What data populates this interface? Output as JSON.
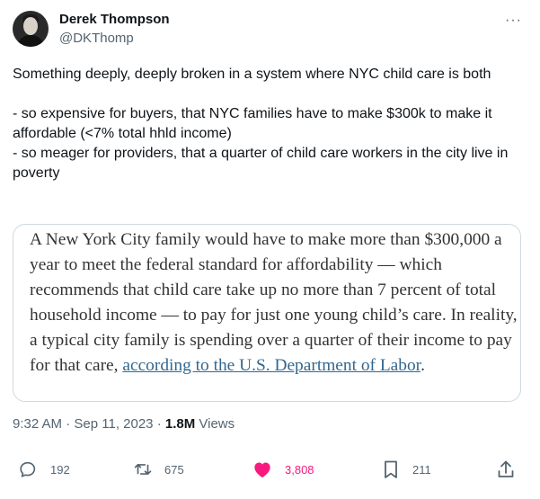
{
  "author": {
    "name": "Derek Thompson",
    "handle": "@DKThomp"
  },
  "more_label": "···",
  "tweet": {
    "text": "Something deeply, deeply broken in a system where NYC child care is both\n\n- so expensive for buyers, that NYC families have to make $300k to make it affordable (<7% total hhld income)\n- so meager for providers, that a quarter of child care workers in the city live in poverty"
  },
  "quote": {
    "text": "A New York City family would have to make more than $300,000 a year to meet the federal standard for affordability — which recommends that child care take up no more than 7 percent of total household income — to pay for just one young child’s care. In reality, a typical city family is spending over a quarter of their income to pay for that care, ",
    "link_text": "according to the U.S. Department of Labor",
    "end": "."
  },
  "meta": {
    "time": "9:32 AM",
    "sep1": " · ",
    "date": "Sep 11, 2023",
    "sep2": " · ",
    "views_count": "1.8M",
    "views_label": " Views"
  },
  "actions": {
    "replies": "192",
    "reposts": "675",
    "likes": "3,808",
    "bookmarks": "211"
  },
  "colors": {
    "like": "#f91880",
    "icon": "#536471",
    "link": "#326891"
  }
}
